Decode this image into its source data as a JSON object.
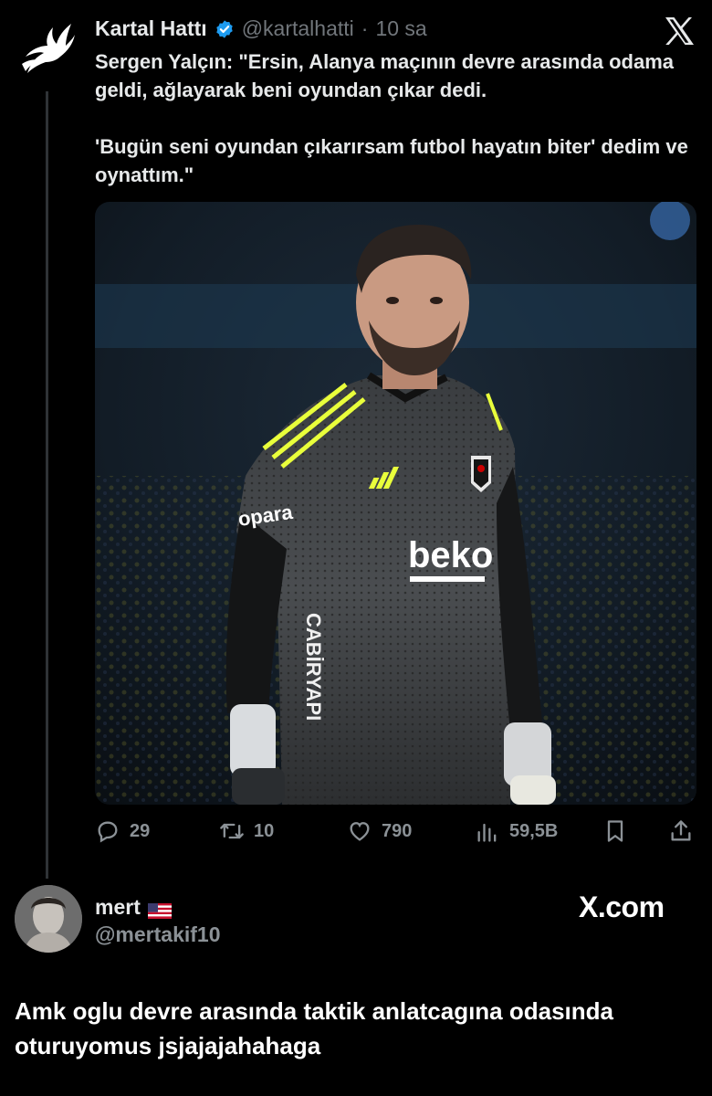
{
  "quoted_tweet": {
    "author_name": "Kartal Hattı",
    "handle": "@kartalhatti",
    "dot": "·",
    "time": "10 sa",
    "text_line1": "Sergen Yalçın: \"Ersin, Alanya maçının devre arasında odama geldi, ağlayarak beni oyundan çıkar dedi.",
    "text_line2": "'Bugün seni oyundan çıkarırsam futbol hayatın biter' dedim ve oynattım.\"",
    "photo": {
      "jersey_sponsor": "beko",
      "sleeve_sponsor": "opara",
      "side_sponsor": "CABİRYAPI"
    },
    "actions": {
      "replies": "29",
      "reposts": "10",
      "likes": "790",
      "views": "59,5B"
    }
  },
  "reply_tweet": {
    "author_name": "mert",
    "handle": "@mertakif10",
    "watermark": "X.com",
    "text": "Amk oglu devre arasında taktik anlatcagına odasında oturuyomus jsjajajahahaga"
  },
  "colors": {
    "background": "#000000",
    "text": "#e7e9ea",
    "secondary": "#71767b",
    "verified": "#1d9bf0",
    "accent_yellow": "#e9ff3b"
  },
  "icons": [
    "eagle-logo-icon",
    "verified-badge-icon",
    "x-logo-icon",
    "reply-icon",
    "repost-icon",
    "like-icon",
    "views-icon",
    "bookmark-icon",
    "share-icon",
    "us-flag-icon"
  ]
}
